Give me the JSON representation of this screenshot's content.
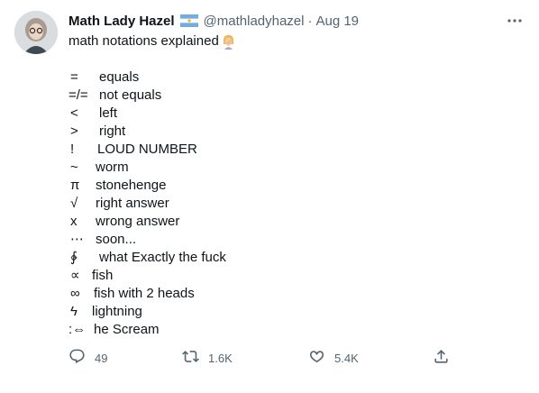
{
  "tweet": {
    "author_name": "Math Lady Hazel",
    "handle": "@mathladyhazel",
    "separator": "·",
    "date": "Aug 19",
    "text_intro": "math notations explained",
    "emoji": "woman-facepalming-emoji",
    "lines": [
      {
        "symbol": "=",
        "text": "equals"
      },
      {
        "symbol": "=/=",
        "text": "not equals"
      },
      {
        "symbol": "<",
        "text": "left"
      },
      {
        "symbol": ">",
        "text": "right"
      },
      {
        "symbol": "!",
        "text": "LOUD NUMBER"
      },
      {
        "symbol": "~",
        "text": "worm"
      },
      {
        "symbol": "π",
        "text": "stonehenge"
      },
      {
        "symbol": "√",
        "text": "right answer"
      },
      {
        "symbol": "x",
        "text": "wrong answer"
      },
      {
        "symbol": "⋯",
        "text": "soon..."
      },
      {
        "symbol": "∲",
        "text": "what Exactly the fuck"
      },
      {
        "symbol": "∝",
        "text": "fish"
      },
      {
        "symbol": "∞",
        "text": "fish with 2 heads"
      },
      {
        "symbol": "ϟ",
        "text": "lightning"
      },
      {
        "symbol": ":⇔",
        "text": "he Scream"
      }
    ],
    "actions": {
      "reply_count": "49",
      "retweet_count": "1.6K",
      "like_count": "5.4K"
    },
    "icons": {
      "more": "more-icon",
      "reply": "reply-icon",
      "retweet": "retweet-icon",
      "like": "heart-icon",
      "share": "share-icon",
      "flag": "argentina-flag-icon"
    },
    "colors": {
      "text": "#0f1419",
      "secondary": "#536471",
      "flag_blue": "#74acdf"
    }
  }
}
